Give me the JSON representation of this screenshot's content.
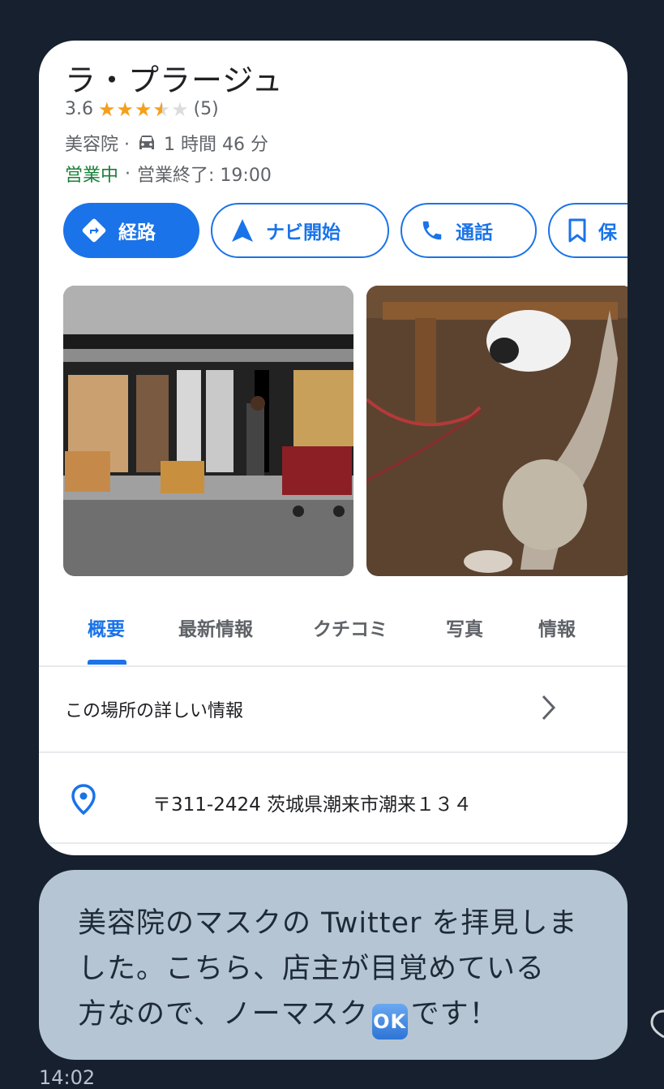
{
  "place": {
    "title": "ラ・プラージュ",
    "rating": "3.6",
    "rating_value": 3.6,
    "review_count": "(5)",
    "category": "美容院 ·",
    "travel_time": "1 時間 46 分",
    "open_status": "営業中",
    "separator": "·",
    "closing": "営業終了: 19:00"
  },
  "actions": {
    "directions": "経路",
    "start": "ナビ開始",
    "call": "通話",
    "save": "保"
  },
  "tabs": [
    "概要",
    "最新情報",
    "クチコミ",
    "写真",
    "情報"
  ],
  "active_tab": "概要",
  "more_info_label": "この場所の詳しい情報",
  "address": "〒311-2424 茨城県潮来市潮来１３４",
  "message": {
    "line1": "美容院のマスクの Twitter を拝見しま",
    "line2": "した。こちら、店主が目覚めている",
    "line3_before": "方なので、ノーマスク",
    "ok_badge": "OK",
    "line3_after": "です！"
  },
  "timestamp": "14:02",
  "colors": {
    "accent": "#1a73e8",
    "open": "#188038",
    "star": "#f4a01c",
    "bubble": "#b5c5d3",
    "background": "#16202e"
  }
}
